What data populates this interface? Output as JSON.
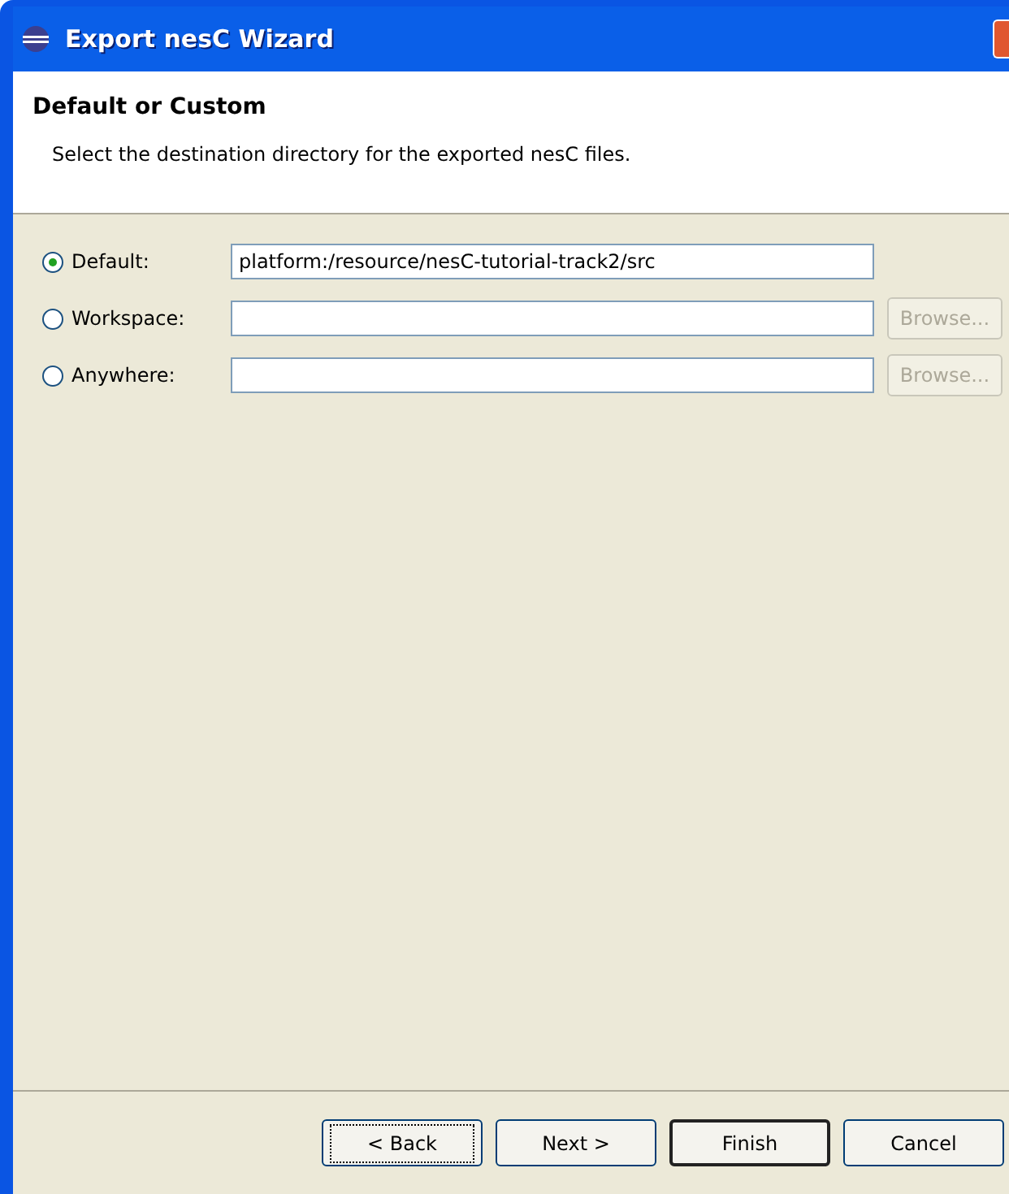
{
  "window": {
    "title": "Export nesC Wizard"
  },
  "header": {
    "title": "Default or Custom",
    "description": "Select the destination directory for the exported nesC files."
  },
  "options": [
    {
      "label": "Default:",
      "selected": true,
      "value": "platform:/resource/nesC-tutorial-track2/src"
    },
    {
      "label": "Workspace:",
      "selected": false,
      "browse": {
        "label": "Browse...",
        "disabled": true
      }
    },
    {
      "label": "Anywhere:",
      "selected": false,
      "browse": {
        "label": "Browse...",
        "disabled": true
      }
    }
  ],
  "buttons": [
    {
      "label": "< Back",
      "focused": true,
      "default": false
    },
    {
      "label": "Next >",
      "focused": false,
      "default": false
    },
    {
      "label": "Finish",
      "focused": false,
      "default": true
    },
    {
      "label": "Cancel",
      "focused": false,
      "default": false
    }
  ]
}
